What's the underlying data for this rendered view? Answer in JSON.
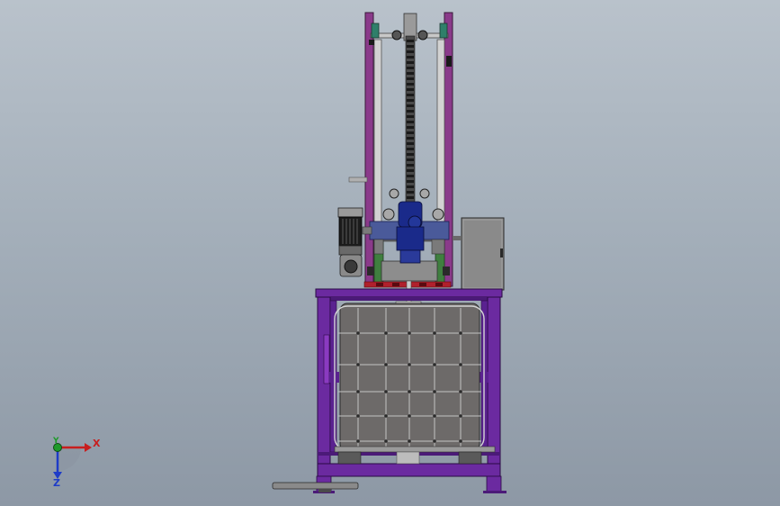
{
  "axes": {
    "x_label": "X",
    "y_label": "Y",
    "z_label": "Z"
  },
  "colors": {
    "frame_purple": "#6b2aa0",
    "frame_purple_dark": "#4b1a78",
    "column_magenta": "#8a3a8a",
    "motor_blue": "#1a2a8a",
    "bracket_green": "#3f7f3f",
    "guide_red": "#b0202c",
    "housing_gray": "#808080",
    "tank_gray": "#6d6a69",
    "axis_x": "#c81e1e",
    "axis_y": "#1e9a2a",
    "axis_z": "#1e3cc8"
  }
}
